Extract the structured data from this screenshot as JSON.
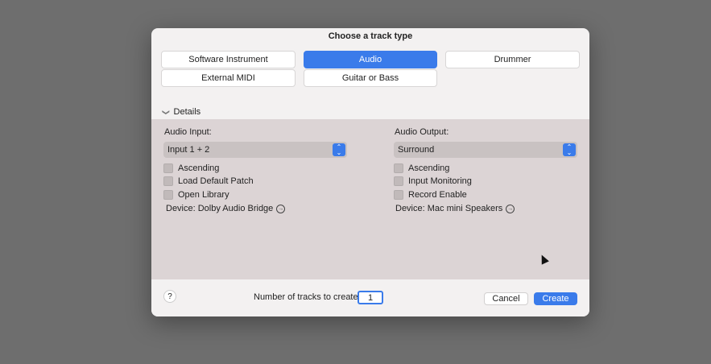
{
  "dialog": {
    "title": "Choose a track type",
    "track_types": [
      {
        "label": "Software Instrument",
        "selected": false
      },
      {
        "label": "Audio",
        "selected": true
      },
      {
        "label": "Drummer",
        "selected": false
      },
      {
        "label": "External MIDI",
        "selected": false
      },
      {
        "label": "Guitar or Bass",
        "selected": false
      }
    ],
    "details_label": "Details",
    "input": {
      "label": "Audio Input:",
      "value": "Input 1 + 2",
      "options": [
        "Ascending",
        "Load Default Patch",
        "Open Library"
      ],
      "device": "Device: Dolby Audio Bridge"
    },
    "output": {
      "label": "Audio Output:",
      "value": "Surround",
      "options": [
        "Ascending",
        "Input Monitoring",
        "Record Enable"
      ],
      "device": "Device: Mac mini Speakers"
    },
    "footer": {
      "help": "?",
      "count_label": "Number of tracks to create:",
      "count_value": "1",
      "cancel": "Cancel",
      "create": "Create"
    }
  },
  "colors": {
    "accent": "#3a7bea",
    "panel": "#dcd4d5",
    "dialog_bg": "#f3f1f1",
    "backdrop": "#6e6e6e"
  },
  "icons": {
    "details_toggle": "chevron-down-icon",
    "device_link": "arrow-right-circle-icon",
    "select_stepper": "up-down-chevron-icon"
  }
}
